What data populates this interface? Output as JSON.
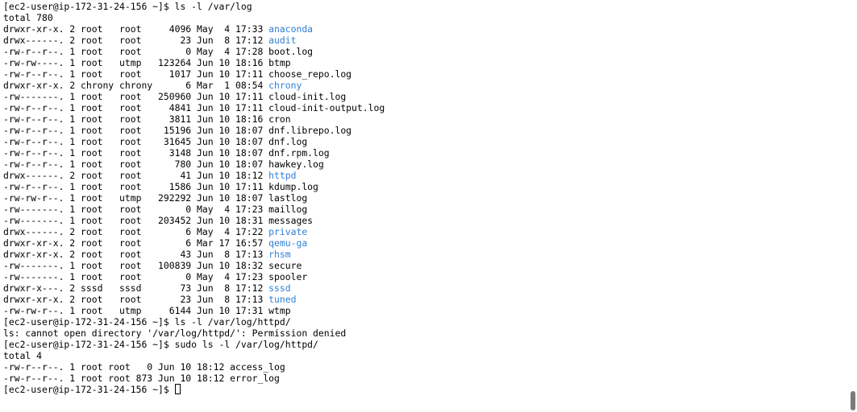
{
  "colors": {
    "background": "#ffffff",
    "text": "#000000",
    "directory": "#2f7fd4",
    "scroll_thumb": "#7a7a7a"
  },
  "prompt": "[ec2-user@ip-172-31-24-156 ~]$ ",
  "commands": {
    "first": "ls -l /var/log",
    "second": "ls -l /var/log/httpd/",
    "third": "sudo ls -l /var/log/httpd/"
  },
  "listing_var_log": {
    "total": "total 780",
    "entries": [
      {
        "perms": "drwxr-xr-x. 2 root   root     4096 May  4 17:33 ",
        "name": "anaconda",
        "type": "dir"
      },
      {
        "perms": "drwx------. 2 root   root       23 Jun  8 17:12 ",
        "name": "audit",
        "type": "dir"
      },
      {
        "perms": "-rw-r--r--. 1 root   root        0 May  4 17:28 ",
        "name": "boot.log",
        "type": "file"
      },
      {
        "perms": "-rw-rw----. 1 root   utmp   123264 Jun 10 18:16 ",
        "name": "btmp",
        "type": "file"
      },
      {
        "perms": "-rw-r--r--. 1 root   root     1017 Jun 10 17:11 ",
        "name": "choose_repo.log",
        "type": "file"
      },
      {
        "perms": "drwxr-xr-x. 2 chrony chrony      6 Mar  1 08:54 ",
        "name": "chrony",
        "type": "dir"
      },
      {
        "perms": "-rw-------. 1 root   root   250960 Jun 10 17:11 ",
        "name": "cloud-init.log",
        "type": "file"
      },
      {
        "perms": "-rw-r--r--. 1 root   root     4841 Jun 10 17:11 ",
        "name": "cloud-init-output.log",
        "type": "file"
      },
      {
        "perms": "-rw-r--r--. 1 root   root     3811 Jun 10 18:16 ",
        "name": "cron",
        "type": "file"
      },
      {
        "perms": "-rw-r--r--. 1 root   root    15196 Jun 10 18:07 ",
        "name": "dnf.librepo.log",
        "type": "file"
      },
      {
        "perms": "-rw-r--r--. 1 root   root    31645 Jun 10 18:07 ",
        "name": "dnf.log",
        "type": "file"
      },
      {
        "perms": "-rw-r--r--. 1 root   root     3148 Jun 10 18:07 ",
        "name": "dnf.rpm.log",
        "type": "file"
      },
      {
        "perms": "-rw-r--r--. 1 root   root      780 Jun 10 18:07 ",
        "name": "hawkey.log",
        "type": "file"
      },
      {
        "perms": "drwx------. 2 root   root       41 Jun 10 18:12 ",
        "name": "httpd",
        "type": "dir"
      },
      {
        "perms": "-rw-r--r--. 1 root   root     1586 Jun 10 17:11 ",
        "name": "kdump.log",
        "type": "file"
      },
      {
        "perms": "-rw-rw-r--. 1 root   utmp   292292 Jun 10 18:07 ",
        "name": "lastlog",
        "type": "file"
      },
      {
        "perms": "-rw-------. 1 root   root        0 May  4 17:23 ",
        "name": "maillog",
        "type": "file"
      },
      {
        "perms": "-rw-------. 1 root   root   203452 Jun 10 18:31 ",
        "name": "messages",
        "type": "file"
      },
      {
        "perms": "drwx------. 2 root   root        6 May  4 17:22 ",
        "name": "private",
        "type": "dir"
      },
      {
        "perms": "drwxr-xr-x. 2 root   root        6 Mar 17 16:57 ",
        "name": "qemu-ga",
        "type": "dir"
      },
      {
        "perms": "drwxr-xr-x. 2 root   root       43 Jun  8 17:13 ",
        "name": "rhsm",
        "type": "dir"
      },
      {
        "perms": "-rw-------. 1 root   root   100839 Jun 10 18:32 ",
        "name": "secure",
        "type": "file"
      },
      {
        "perms": "-rw-------. 1 root   root        0 May  4 17:23 ",
        "name": "spooler",
        "type": "file"
      },
      {
        "perms": "drwxr-x---. 2 sssd   sssd       73 Jun  8 17:12 ",
        "name": "sssd",
        "type": "dir"
      },
      {
        "perms": "drwxr-xr-x. 2 root   root       23 Jun  8 17:13 ",
        "name": "tuned",
        "type": "dir"
      },
      {
        "perms": "-rw-rw-r--. 1 root   utmp     6144 Jun 10 17:31 ",
        "name": "wtmp",
        "type": "file"
      }
    ]
  },
  "error_message": "ls: cannot open directory '/var/log/httpd/': Permission denied",
  "listing_httpd": {
    "total": "total 4",
    "entries": [
      {
        "perms": "-rw-r--r--. 1 root root   0 Jun 10 18:12 ",
        "name": "access_log",
        "type": "file"
      },
      {
        "perms": "-rw-r--r--. 1 root root 873 Jun 10 18:12 ",
        "name": "error_log",
        "type": "file"
      }
    ]
  }
}
